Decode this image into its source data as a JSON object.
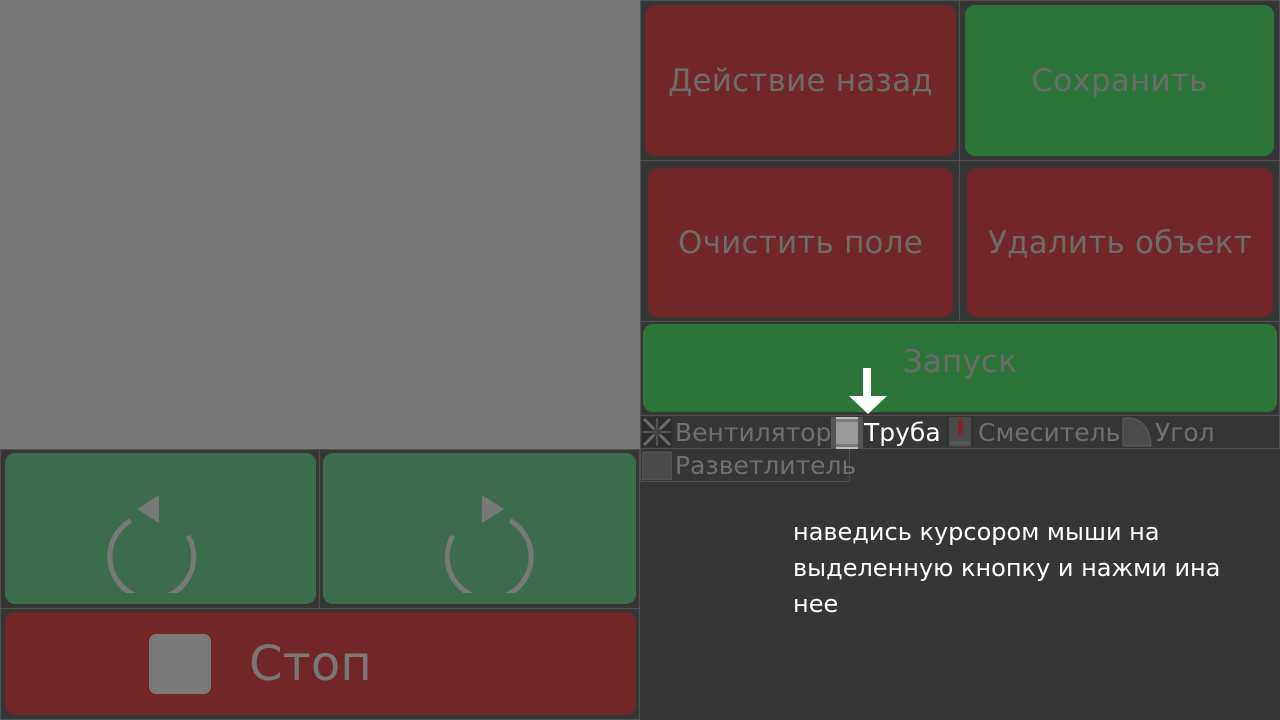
{
  "actions": {
    "undo_label": "Действие назад",
    "save_label": "Сохранить",
    "clear_label": "Очистить поле",
    "delete_label": "Удалить объект",
    "run_label": "Запуск"
  },
  "palette": {
    "items": [
      {
        "label": "Вентилятор",
        "icon": "fan-icon"
      },
      {
        "label": "Труба",
        "icon": "pipe-icon",
        "highlighted": true
      },
      {
        "label": "Смеситель",
        "icon": "mixer-icon"
      },
      {
        "label": "Угол",
        "icon": "corner-icon"
      },
      {
        "label": "Разветлитель",
        "icon": "splitter-icon"
      }
    ]
  },
  "controls": {
    "rotate_left_icon": "rotate-ccw-icon",
    "rotate_right_icon": "rotate-cw-icon",
    "stop_label": "Стоп",
    "stop_icon": "stop-square-icon"
  },
  "hint": {
    "text": "наведись курсором мыши на выделенную кнопку и нажми ина нее"
  },
  "colors": {
    "red": "#722627",
    "green": "#2a7537",
    "dark_green": "#3d6b4e",
    "canvas": "#787878",
    "background": "#363636"
  }
}
